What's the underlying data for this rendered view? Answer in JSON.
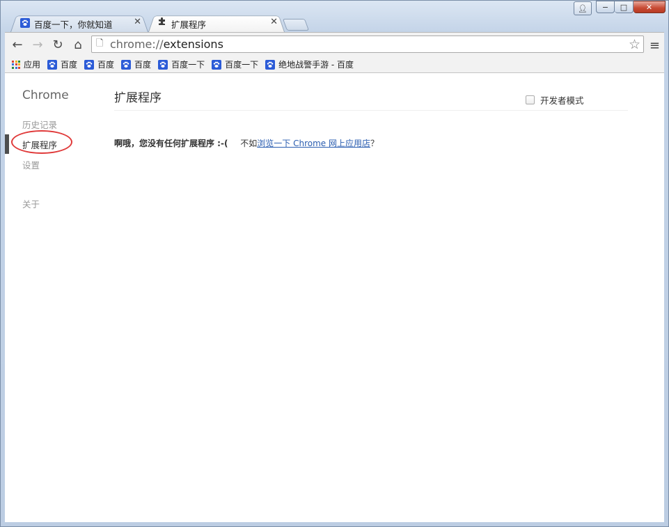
{
  "tabs": [
    {
      "title": "百度一下，你就知道",
      "icon": "baidu-paw-icon",
      "active": false
    },
    {
      "title": "扩展程序",
      "icon": "puzzle-icon",
      "active": true
    }
  ],
  "toolbar": {
    "url_scheme": "chrome://",
    "url_path": "extensions"
  },
  "bookmarks": [
    {
      "label": "应用",
      "icon": "apps-grid-icon"
    },
    {
      "label": "百度",
      "icon": "baidu-paw-icon"
    },
    {
      "label": "百度",
      "icon": "baidu-paw-icon"
    },
    {
      "label": "百度",
      "icon": "baidu-paw-icon"
    },
    {
      "label": "百度一下",
      "icon": "baidu-paw-icon"
    },
    {
      "label": "百度一下",
      "icon": "baidu-paw-icon"
    },
    {
      "label": "绝地战警手游 - 百度",
      "icon": "baidu-paw-icon"
    }
  ],
  "sidebar": {
    "brand": "Chrome",
    "items": [
      {
        "label": "历史记录",
        "selected": false
      },
      {
        "label": "扩展程序",
        "selected": true
      },
      {
        "label": "设置",
        "selected": false
      },
      {
        "label": "关于",
        "selected": false
      }
    ]
  },
  "main": {
    "title": "扩展程序",
    "dev_mode_label": "开发者模式",
    "empty_bold": "啊哦，您没有任何扩展程序 :-(",
    "empty_prefix": "不如",
    "empty_link": "浏览一下 Chrome 网上应用店",
    "empty_suffix": "？"
  },
  "colors": {
    "annotation_circle": "#e03a3a",
    "link": "#2a5db0",
    "baidu_blue": "#2b5bd7"
  }
}
